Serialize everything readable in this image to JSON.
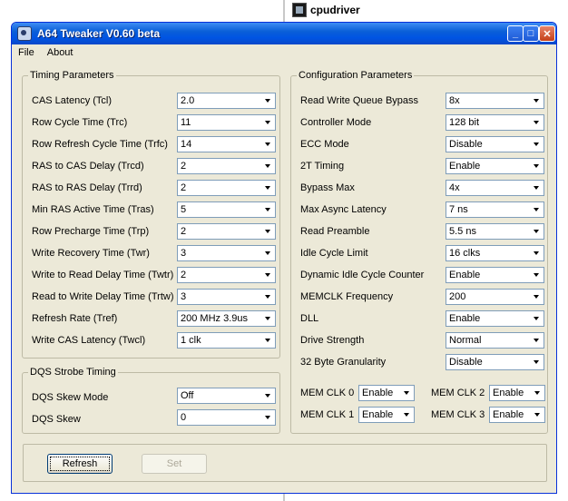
{
  "desktop": {
    "label": "cpudriver"
  },
  "window": {
    "title": "A64 Tweaker V0.60 beta",
    "controls": {
      "minimize": "_",
      "maximize": "□",
      "close": "✕"
    }
  },
  "menu": [
    "File",
    "About"
  ],
  "timing": {
    "title": "Timing Parameters",
    "rows": [
      {
        "label": "CAS Latency (Tcl)",
        "value": "2.0"
      },
      {
        "label": "Row Cycle Time (Trc)",
        "value": "11"
      },
      {
        "label": "Row Refresh Cycle Time (Trfc)",
        "value": "14"
      },
      {
        "label": "RAS to CAS Delay (Trcd)",
        "value": "2"
      },
      {
        "label": "RAS to RAS Delay (Trrd)",
        "value": "2"
      },
      {
        "label": "Min RAS Active Time (Tras)",
        "value": "5"
      },
      {
        "label": "Row Precharge Time (Trp)",
        "value": "2"
      },
      {
        "label": "Write Recovery Time (Twr)",
        "value": "3"
      },
      {
        "label": "Write to Read Delay Time (Twtr)",
        "value": "2"
      },
      {
        "label": "Read to Write Delay Time (Trtw)",
        "value": "3"
      },
      {
        "label": "Refresh Rate (Tref)",
        "value": "200 MHz 3.9us"
      },
      {
        "label": "Write CAS Latency (Twcl)",
        "value": "1 clk"
      }
    ]
  },
  "dqs": {
    "title": "DQS Strobe Timing",
    "rows": [
      {
        "label": "DQS Skew Mode",
        "value": "Off"
      },
      {
        "label": "DQS Skew",
        "value": "0"
      }
    ]
  },
  "config": {
    "title": "Configuration Parameters",
    "rows": [
      {
        "label": "Read Write Queue Bypass",
        "value": "8x"
      },
      {
        "label": "Controller Mode",
        "value": "128 bit"
      },
      {
        "label": "ECC Mode",
        "value": "Disable"
      },
      {
        "label": "2T Timing",
        "value": "Enable"
      },
      {
        "label": "Bypass Max",
        "value": "4x"
      },
      {
        "label": "Max Async Latency",
        "value": "7 ns"
      },
      {
        "label": "Read Preamble",
        "value": "5.5 ns"
      },
      {
        "label": "Idle Cycle Limit",
        "value": "16 clks"
      },
      {
        "label": "Dynamic Idle Cycle Counter",
        "value": "Enable"
      },
      {
        "label": "MEMCLK Frequency",
        "value": "200"
      },
      {
        "label": "DLL",
        "value": "Enable"
      },
      {
        "label": "Drive Strength",
        "value": "Normal"
      },
      {
        "label": "32 Byte Granularity",
        "value": "Disable"
      }
    ],
    "memclk": [
      {
        "label": "MEM CLK 0",
        "value": "Enable"
      },
      {
        "label": "MEM CLK 2",
        "value": "Enable"
      },
      {
        "label": "MEM CLK 1",
        "value": "Enable"
      },
      {
        "label": "MEM CLK 3",
        "value": "Enable"
      }
    ]
  },
  "buttons": {
    "refresh": "Refresh",
    "set": "Set"
  }
}
